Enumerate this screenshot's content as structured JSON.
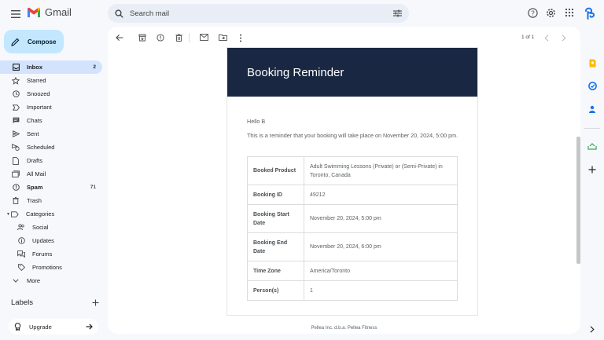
{
  "app": {
    "name": "Gmail"
  },
  "search": {
    "placeholder": "Search mail"
  },
  "compose": {
    "label": "Compose"
  },
  "sidebar": {
    "items": [
      {
        "label": "Inbox",
        "count": "2",
        "icon": "inbox-icon"
      },
      {
        "label": "Starred",
        "count": "",
        "icon": "star-icon"
      },
      {
        "label": "Snoozed",
        "count": "",
        "icon": "clock-icon"
      },
      {
        "label": "Important",
        "count": "",
        "icon": "important-icon"
      },
      {
        "label": "Chats",
        "count": "",
        "icon": "chat-icon"
      },
      {
        "label": "Sent",
        "count": "",
        "icon": "send-icon"
      },
      {
        "label": "Scheduled",
        "count": "",
        "icon": "scheduled-send-icon"
      },
      {
        "label": "Drafts",
        "count": "",
        "icon": "draft-icon"
      },
      {
        "label": "All Mail",
        "count": "",
        "icon": "all-mail-icon"
      },
      {
        "label": "Spam",
        "count": "71",
        "icon": "spam-icon"
      },
      {
        "label": "Trash",
        "count": "",
        "icon": "trash-icon"
      },
      {
        "label": "Categories",
        "count": "",
        "icon": "label-icon"
      },
      {
        "label": "Social",
        "count": "",
        "icon": "people-icon"
      },
      {
        "label": "Updates",
        "count": "",
        "icon": "info-icon"
      },
      {
        "label": "Forums",
        "count": "",
        "icon": "forum-icon"
      },
      {
        "label": "Promotions",
        "count": "",
        "icon": "tag-icon"
      },
      {
        "label": "More",
        "count": "",
        "icon": "chevron-down-icon"
      }
    ],
    "labels_heading": "Labels",
    "upgrade_label": "Upgrade"
  },
  "toolbar": {
    "pager": "1 of 1"
  },
  "email": {
    "banner_title": "Booking Reminder",
    "greeting": "Hello B",
    "reminder_text": "This is a reminder that your booking will take place on November 20, 2024, 5:00 pm.",
    "details": [
      {
        "key": "Booked Product",
        "value": "Adult Swimming Lessons (Private) or (Semi-Private) in Toronto, Canada"
      },
      {
        "key": "Booking ID",
        "value": "49212"
      },
      {
        "key": "Booking Start Date",
        "value": "November 20, 2024, 5:00 pm"
      },
      {
        "key": "Booking End Date",
        "value": "November 20, 2024, 6:00 pm"
      },
      {
        "key": "Time Zone",
        "value": "America/Toronto"
      },
      {
        "key": "Person(s)",
        "value": "1"
      }
    ],
    "footer": "Pellea Inc. d.b.a. Pellea Fitness"
  },
  "colors": {
    "banner": "#192742",
    "compose_bg": "#c2e7ff",
    "active_nav": "#d3e3fd"
  }
}
